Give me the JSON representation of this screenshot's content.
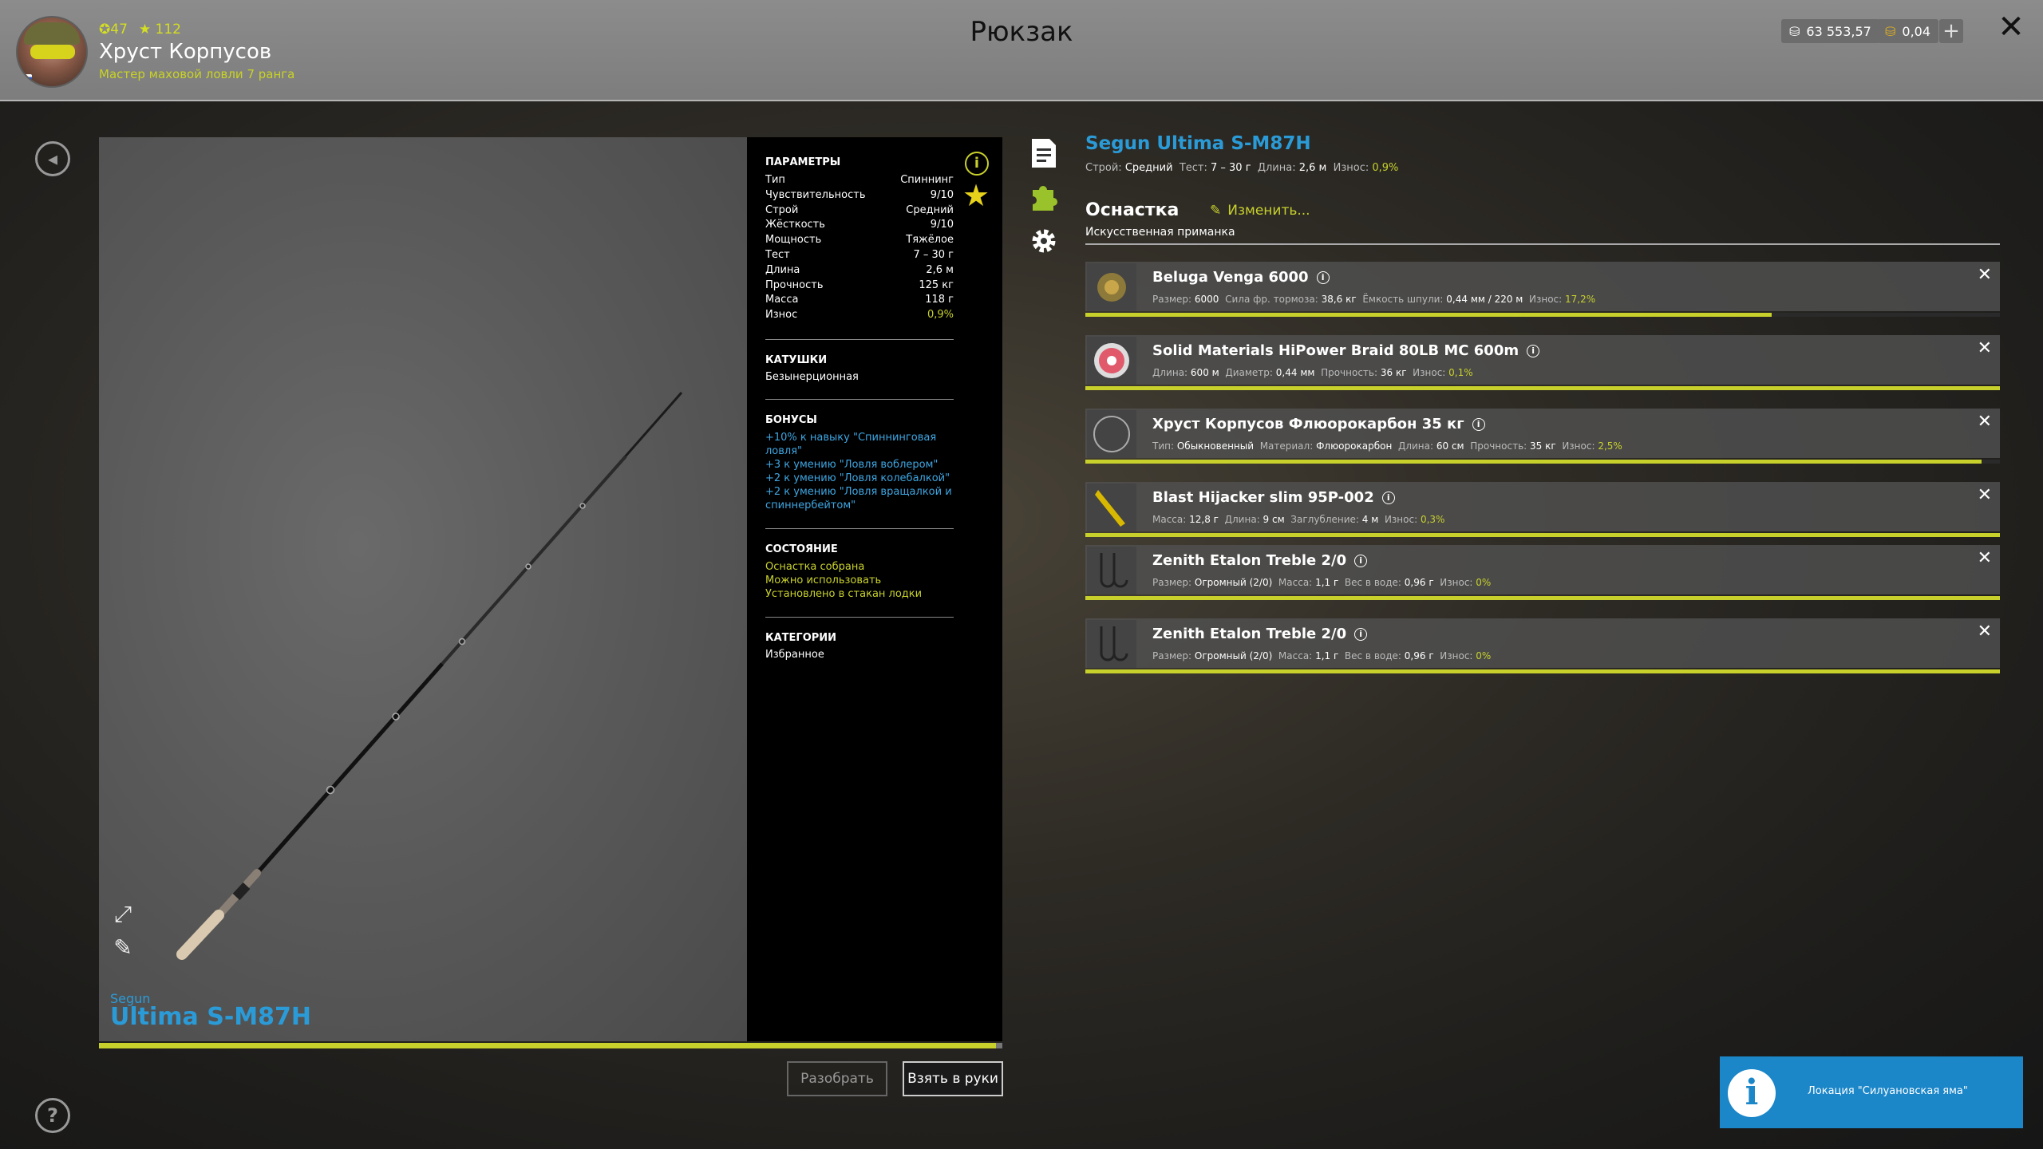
{
  "header": {
    "title": "Рюкзак",
    "player": {
      "name": "Хруст Корпусов",
      "level": "47",
      "rating": "112",
      "rank": "Мастер маховой ловли 7 ранга"
    },
    "currency": {
      "silver": "63 553,57",
      "gold": "0,04",
      "add_label": "+"
    },
    "close_label": "✕"
  },
  "viewer": {
    "brand": "Segun",
    "model": "Ultima S-M87H",
    "expand_icon": "expand-icon",
    "edit_icon": "pencil-icon"
  },
  "params": {
    "section_params": "ПАРАМЕТРЫ",
    "rows": [
      {
        "label": "Тип",
        "value": "Спиннинг"
      },
      {
        "label": "Чувствительность",
        "value": "9/10"
      },
      {
        "label": "Строй",
        "value": "Средний"
      },
      {
        "label": "Жёсткость",
        "value": "9/10"
      },
      {
        "label": "Мощность",
        "value": "Тяжёлое"
      },
      {
        "label": "Тест",
        "value": "7 – 30 г"
      },
      {
        "label": "Длина",
        "value": "2,6 м"
      },
      {
        "label": "Прочность",
        "value": "125 кг"
      },
      {
        "label": "Масса",
        "value": "118 г"
      },
      {
        "label": "Износ",
        "value": "0,9%"
      }
    ],
    "section_reels": "КАТУШКИ",
    "reels": "Безынерционная",
    "section_bonuses": "БОНУСЫ",
    "bonuses": [
      "+10% к навыку \"Спиннинговая ловля\"",
      "+3 к умению \"Ловля воблером\"",
      "+2 к умению \"Ловля колебалкой\"",
      "+2 к умению \"Ловля вращалкой и спиннербейтом\""
    ],
    "section_state": "СОСТОЯНИЕ",
    "states": [
      "Оснастка собрана",
      "Можно использовать",
      "Установлено в стакан лодки"
    ],
    "section_categories": "КАТЕГОРИИ",
    "category": "Избранное"
  },
  "buttons": {
    "disassemble": "Разобрать",
    "take": "Взять в руки"
  },
  "rod": {
    "title": "Segun Ultima S-M87H",
    "props": [
      {
        "label": "Строй:",
        "value": "Средний"
      },
      {
        "label": "Тест:",
        "value": "7 – 30 г"
      },
      {
        "label": "Длина:",
        "value": "2,6 м"
      },
      {
        "label": "Износ:",
        "value": "0,9%"
      }
    ]
  },
  "tackle": {
    "title": "Оснастка",
    "change_label": "Изменить...",
    "subtitle": "Искусственная приманка",
    "items": [
      {
        "name": "Beluga Venga 6000",
        "wear_level": 0.75,
        "props": [
          {
            "label": "Размер:",
            "value": "6000"
          },
          {
            "label": "Сила фр. тормоза:",
            "value": "38,6 кг"
          },
          {
            "label": "Ёмкость шпули:",
            "value": "0,44 мм / 220 м"
          },
          {
            "label": "Износ:",
            "value": "17,2%"
          }
        ]
      },
      {
        "name": "Solid Materials HiPower Braid 80LB MC 600m",
        "wear_level": 1.0,
        "props": [
          {
            "label": "Длина:",
            "value": "600 м"
          },
          {
            "label": "Диаметр:",
            "value": "0,44 мм"
          },
          {
            "label": "Прочность:",
            "value": "36 кг"
          },
          {
            "label": "Износ:",
            "value": "0,1%"
          }
        ]
      },
      {
        "name": "Хруст Корпусов Флюорокарбон 35 кг",
        "wear_level": 0.98,
        "props": [
          {
            "label": "Тип:",
            "value": "Обыкновенный"
          },
          {
            "label": "Материал:",
            "value": "Флюорокарбон"
          },
          {
            "label": "Длина:",
            "value": "60 см"
          },
          {
            "label": "Прочность:",
            "value": "35 кг"
          },
          {
            "label": "Износ:",
            "value": "2,5%"
          }
        ]
      },
      {
        "name": "Blast Hijacker slim 95P-002",
        "wear_level": 1.0,
        "props": [
          {
            "label": "Масса:",
            "value": "12,8 г"
          },
          {
            "label": "Длина:",
            "value": "9 см"
          },
          {
            "label": "Заглубление:",
            "value": "4 м"
          },
          {
            "label": "Износ:",
            "value": "0,3%"
          }
        ]
      },
      {
        "name": "Zenith Etalon Treble 2/0",
        "wear_level": 1.0,
        "props": [
          {
            "label": "Размер:",
            "value": "Огромный (2/0)"
          },
          {
            "label": "Масса:",
            "value": "1,1 г"
          },
          {
            "label": "Вес в воде:",
            "value": "0,96 г"
          },
          {
            "label": "Износ:",
            "value": "0%"
          }
        ]
      },
      {
        "name": "Zenith Etalon Treble 2/0",
        "wear_level": 1.0,
        "props": [
          {
            "label": "Размер:",
            "value": "Огромный (2/0)"
          },
          {
            "label": "Масса:",
            "value": "1,1 г"
          },
          {
            "label": "Вес в воде:",
            "value": "0,96 г"
          },
          {
            "label": "Износ:",
            "value": "0%"
          }
        ]
      }
    ]
  },
  "toast": {
    "text": "Локация \"Силуановская яма\""
  },
  "colors": {
    "accent": "#c8d12c",
    "link_blue": "#2b9bd8",
    "toast": "#1b86c8"
  }
}
